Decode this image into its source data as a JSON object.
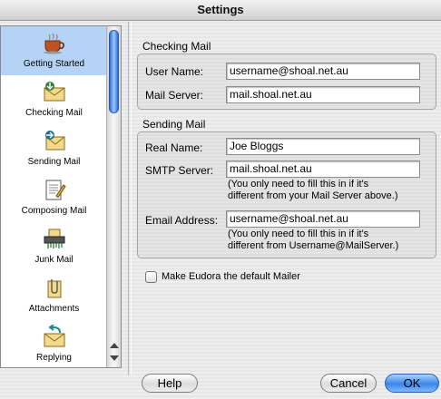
{
  "window": {
    "title": "Settings"
  },
  "sidebar": {
    "items": [
      {
        "label": "Getting Started",
        "icon": "coffee-cup-icon",
        "selected": true
      },
      {
        "label": "Checking Mail",
        "icon": "envelope-download-icon",
        "selected": false
      },
      {
        "label": "Sending Mail",
        "icon": "envelope-send-icon",
        "selected": false
      },
      {
        "label": "Composing Mail",
        "icon": "document-pen-icon",
        "selected": false
      },
      {
        "label": "Junk Mail",
        "icon": "shredder-icon",
        "selected": false
      },
      {
        "label": "Attachments",
        "icon": "paperclip-document-icon",
        "selected": false
      },
      {
        "label": "Replying",
        "icon": "envelope-reply-icon",
        "selected": false
      }
    ]
  },
  "checking_mail": {
    "title": "Checking Mail",
    "user_name_label": "User Name:",
    "user_name_value": "username@shoal.net.au",
    "mail_server_label": "Mail Server:",
    "mail_server_value": "mail.shoal.net.au"
  },
  "sending_mail": {
    "title": "Sending Mail",
    "real_name_label": "Real Name:",
    "real_name_value": "Joe Bloggs",
    "smtp_label": "SMTP Server:",
    "smtp_value": "mail.shoal.net.au",
    "smtp_note_line1": "(You only need to fill this in if it's",
    "smtp_note_line2": "different from your Mail Server above.)",
    "email_label": "Email Address:",
    "email_value": "username@shoal.net.au",
    "email_note_line1": "(You only need to fill this in if it's",
    "email_note_line2": "different from Username@MailServer.)"
  },
  "default_mailer": {
    "label": "Make Eudora the default Mailer",
    "checked": false
  },
  "buttons": {
    "help": "Help",
    "cancel": "Cancel",
    "ok": "OK"
  },
  "colors": {
    "selection": "#b5d3f5",
    "accent": "#3b86e8"
  }
}
